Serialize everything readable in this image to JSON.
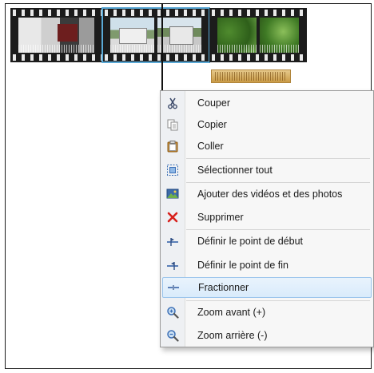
{
  "menu": {
    "items": [
      {
        "label": "Couper",
        "icon": "scissors-icon"
      },
      {
        "label": "Copier",
        "icon": "copy-icon"
      },
      {
        "label": "Coller",
        "icon": "paste-icon"
      },
      {
        "label": "Sélectionner tout",
        "icon": "select-all-icon"
      },
      {
        "label": "Ajouter des vidéos et des photos",
        "icon": "add-media-icon"
      },
      {
        "label": "Supprimer",
        "icon": "delete-icon"
      },
      {
        "label": "Définir le point de début",
        "icon": "set-start-point-icon"
      },
      {
        "label": "Définir le point de fin",
        "icon": "set-end-point-icon"
      },
      {
        "label": "Fractionner",
        "icon": "split-icon"
      },
      {
        "label": "Zoom avant (+)",
        "icon": "zoom-in-icon"
      },
      {
        "label": "Zoom arrière (-)",
        "icon": "zoom-out-icon"
      }
    ],
    "highlighted_index": 8
  },
  "colors": {
    "selection_outline": "#5aa9d6",
    "highlight_bg": "#d9ebfb",
    "delete_red": "#d8201c",
    "audio_track": "#d4aa5c"
  }
}
